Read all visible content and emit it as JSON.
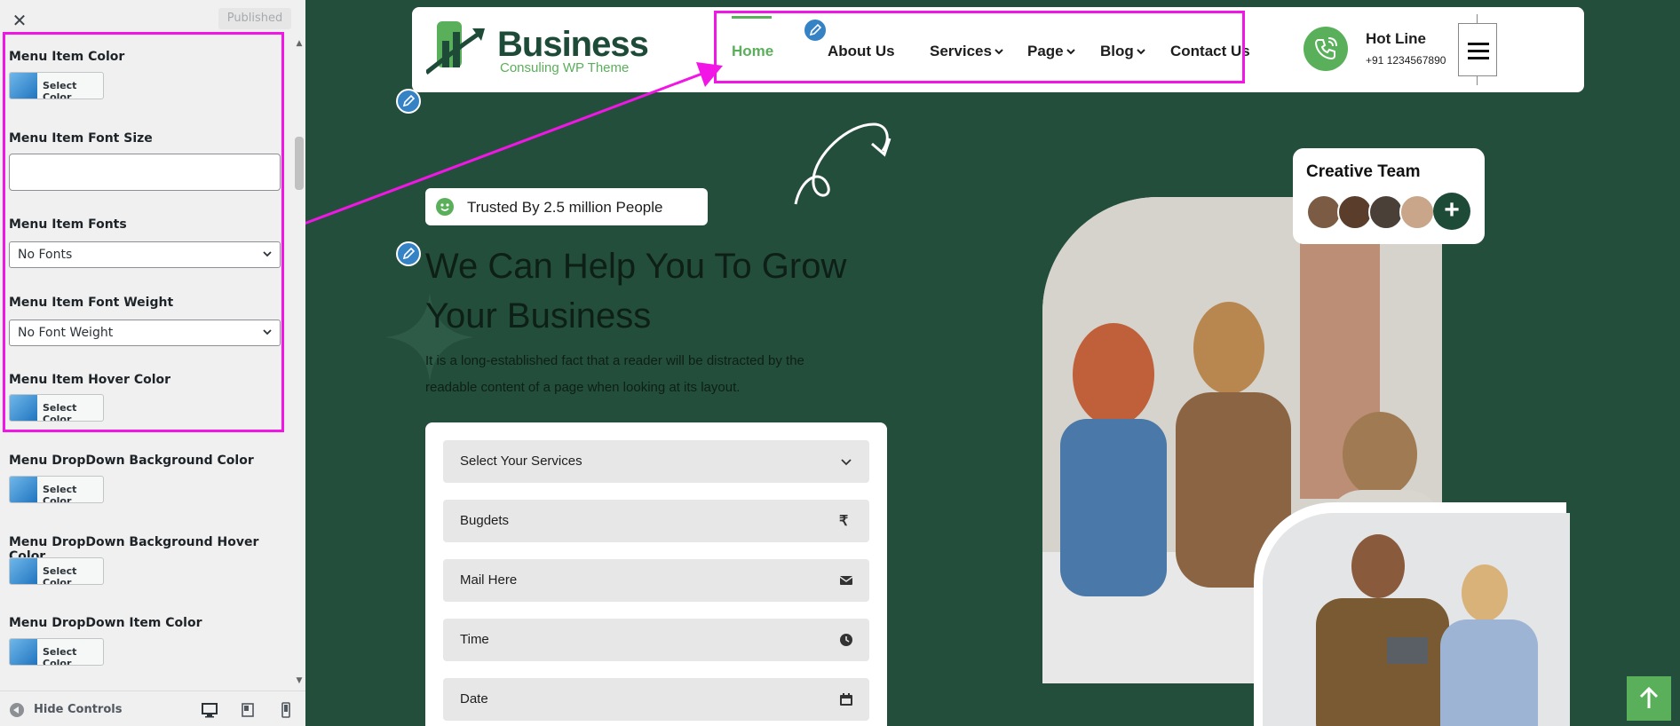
{
  "customizer": {
    "published_label": "Published",
    "controls": {
      "menu_item_color": {
        "label": "Menu Item Color",
        "button": "Select Color"
      },
      "menu_item_font_size": {
        "label": "Menu Item Font Size",
        "value": ""
      },
      "menu_item_fonts": {
        "label": "Menu Item Fonts",
        "selected": "No Fonts"
      },
      "menu_item_font_weight": {
        "label": "Menu Item Font Weight",
        "selected": "No Font Weight"
      },
      "menu_item_hover_color": {
        "label": "Menu Item Hover Color",
        "button": "Select Color"
      },
      "dropdown_bg_color": {
        "label": "Menu DropDown Background Color",
        "button": "Select Color"
      },
      "dropdown_bg_hover_color": {
        "label": "Menu DropDown Background Hover Color",
        "button": "Select Color"
      },
      "dropdown_item_color": {
        "label": "Menu DropDown Item Color",
        "button": "Select Color"
      }
    },
    "hide_controls_label": "Hide Controls",
    "devices": [
      "desktop",
      "tablet",
      "mobile"
    ],
    "highlight_color": "#f116e5"
  },
  "site": {
    "logo": {
      "name": "Business",
      "tagline": "Consuling WP Theme"
    },
    "nav": {
      "items": [
        {
          "label": "Home",
          "active": true,
          "dropdown": false
        },
        {
          "label": "About Us",
          "active": false,
          "dropdown": false
        },
        {
          "label": "Services",
          "active": false,
          "dropdown": true
        },
        {
          "label": "Page",
          "active": false,
          "dropdown": true
        },
        {
          "label": "Blog",
          "active": false,
          "dropdown": true
        },
        {
          "label": "Contact Us",
          "active": false,
          "dropdown": false
        }
      ]
    },
    "hotline": {
      "label": "Hot Line",
      "number": "+91 1234567890"
    },
    "hero": {
      "badge": "Trusted By 2.5 million People",
      "headline": "We Can Help You To Grow Your Business",
      "description": "It is a long-established fact that a reader will be distracted by the readable content of a page when looking at its layout."
    },
    "form": {
      "fields": [
        {
          "label": "Select Your Services",
          "icon": "chevron-down-icon"
        },
        {
          "label": "Bugdets",
          "icon": "rupee-icon"
        },
        {
          "label": "Mail Here",
          "icon": "envelope-icon"
        },
        {
          "label": "Time",
          "icon": "clock-icon"
        },
        {
          "label": "Date",
          "icon": "calendar-icon"
        }
      ]
    },
    "team": {
      "title": "Creative Team",
      "plus": "+"
    },
    "colors": {
      "primary_green": "#5ab05a",
      "dark_green": "#244e3c",
      "brand_dark": "#1e4b38",
      "edit_blue": "#3582c4"
    }
  }
}
